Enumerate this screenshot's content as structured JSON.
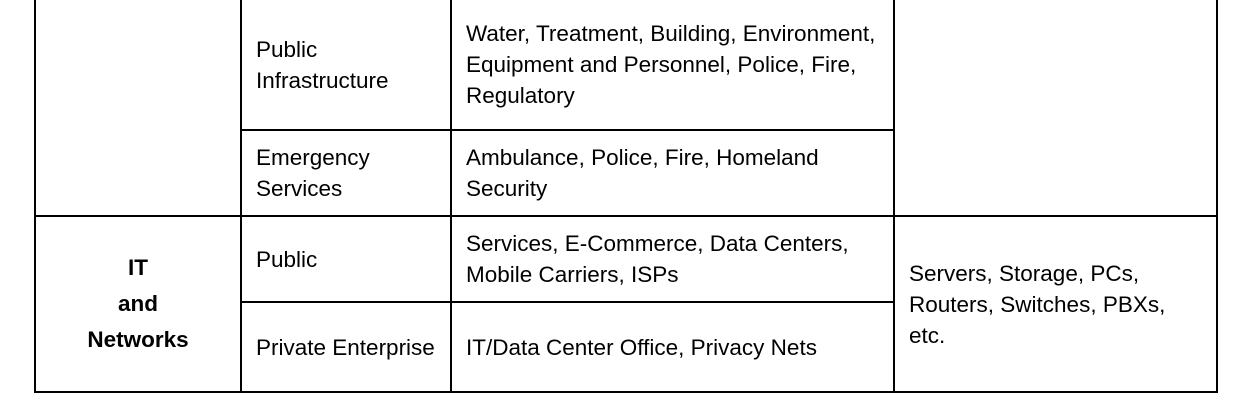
{
  "table": {
    "rows": [
      {
        "category": "",
        "subsector": "Public Infrastructure",
        "examples": "Water, Treatment, Building, Environment, Equipment and Personnel, Police, Fire, Regulatory"
      },
      {
        "subsector": "Emergency Services",
        "examples": "Ambulance, Police, Fire, Homeland Security"
      },
      {
        "category_lines": [
          "IT",
          "and",
          "Networks"
        ],
        "subsector": "Public",
        "examples": "Services, E-Commerce, Data Centers, Mobile Carriers, ISPs",
        "assets": "Servers, Storage, PCs, Routers, Switches, PBXs, etc."
      },
      {
        "subsector": "Private Enterprise",
        "examples": "IT/Data Center Office, Privacy Nets"
      }
    ]
  }
}
